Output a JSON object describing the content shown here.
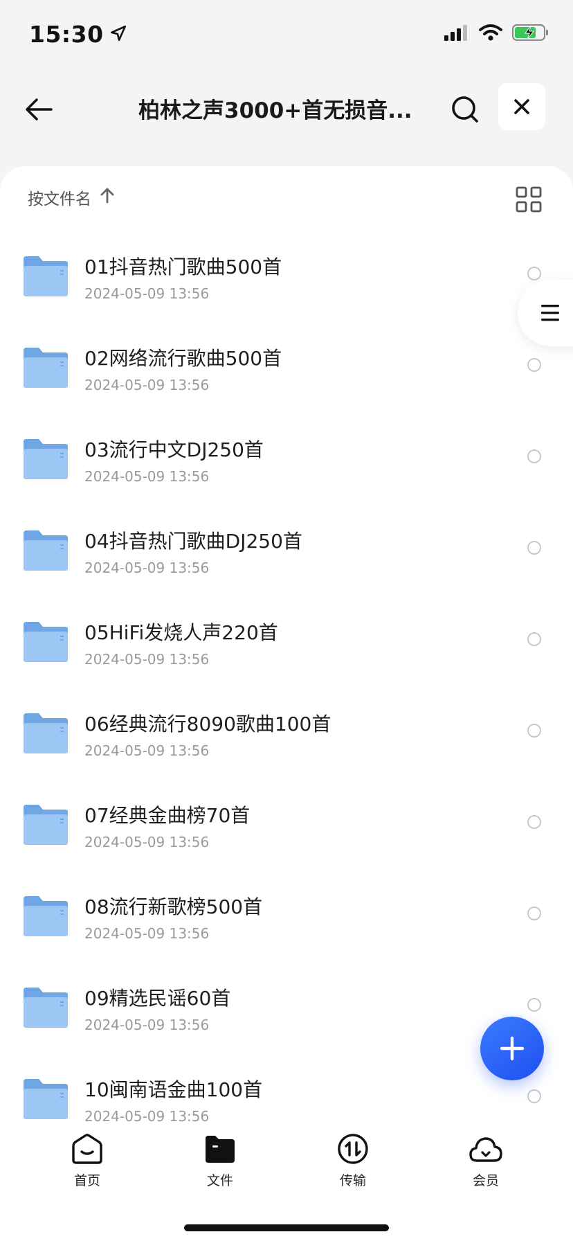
{
  "status_bar": {
    "time": "15:30"
  },
  "header": {
    "title": "柏林之声3000+首无损音..."
  },
  "sort": {
    "label": "按文件名"
  },
  "files": [
    {
      "name": "01抖音热门歌曲500首",
      "date": "2024-05-09 13:56"
    },
    {
      "name": "02网络流行歌曲500首",
      "date": "2024-05-09 13:56"
    },
    {
      "name": "03流行中文DJ250首",
      "date": "2024-05-09 13:56"
    },
    {
      "name": "04抖音热门歌曲DJ250首",
      "date": "2024-05-09 13:56"
    },
    {
      "name": "05HiFi发烧人声220首",
      "date": "2024-05-09 13:56"
    },
    {
      "name": "06经典流行8090歌曲100首",
      "date": "2024-05-09 13:56"
    },
    {
      "name": "07经典金曲榜70首",
      "date": "2024-05-09 13:56"
    },
    {
      "name": "08流行新歌榜500首",
      "date": "2024-05-09 13:56"
    },
    {
      "name": "09精选民谣60首",
      "date": "2024-05-09 13:56"
    },
    {
      "name": "10闽南语金曲100首",
      "date": "2024-05-09 13:56"
    }
  ],
  "tabs": [
    {
      "label": "首页",
      "icon": "home-icon"
    },
    {
      "label": "文件",
      "icon": "folder-icon"
    },
    {
      "label": "传输",
      "icon": "transfer-icon"
    },
    {
      "label": "会员",
      "icon": "cloud-icon"
    }
  ],
  "colors": {
    "accent": "#2f66f6",
    "folder": "#7fb3ec"
  }
}
